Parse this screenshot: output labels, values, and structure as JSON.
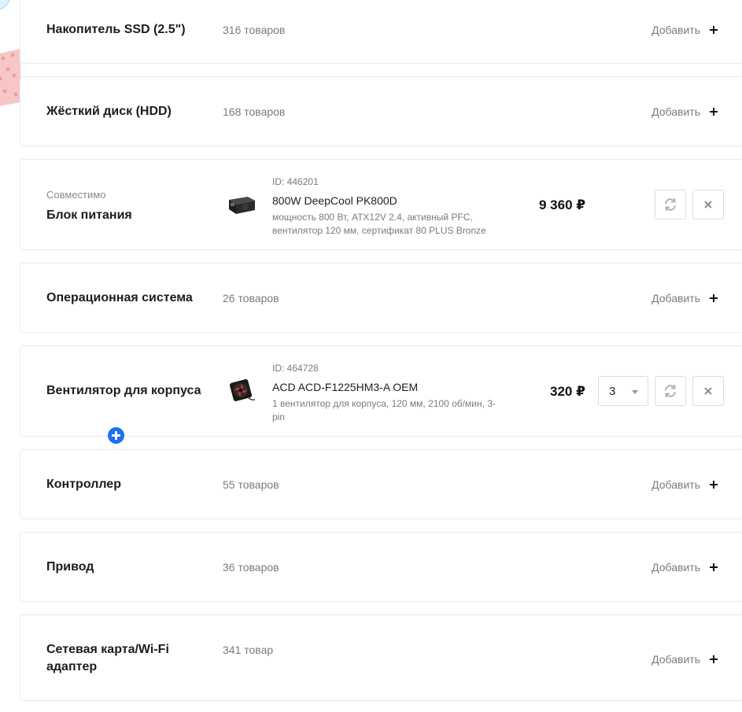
{
  "rows": {
    "ssd": {
      "title": "Накопитель SSD (2.5\")",
      "count": "316 товаров",
      "add_label": "Добавить"
    },
    "hdd": {
      "title": "Жёсткий диск (HDD)",
      "count": "168 товаров",
      "add_label": "Добавить"
    },
    "psu": {
      "status": "Совместимо",
      "title": "Блок питания",
      "product": {
        "id": "ID: 446201",
        "name": "800W DeepCool PK800D",
        "desc": "мощность 800 Вт, ATX12V 2.4, активный PFC, вентилятор 120 мм, сертификат 80 PLUS Bronze",
        "price": "9 360 ₽"
      }
    },
    "os": {
      "title": "Операционная система",
      "count": "26 товаров",
      "add_label": "Добавить"
    },
    "fan": {
      "title": "Вентилятор для корпуса",
      "product": {
        "id": "ID: 464728",
        "name": "ACD ACD-F1225HM3-A OEM",
        "desc": "1 вентилятор для корпуса, 120 мм, 2100 об/мин, 3-pin",
        "price": "320 ₽",
        "quantity": "3"
      }
    },
    "controller": {
      "title": "Контроллер",
      "count": "55 товаров",
      "add_label": "Добавить"
    },
    "drive": {
      "title": "Привод",
      "count": "36 товаров",
      "add_label": "Добавить"
    },
    "network": {
      "title": "Сетевая карта/Wi-Fi адаптер",
      "count": "341 товар",
      "add_label": "Добавить"
    }
  },
  "icons": {
    "add": "plus-icon",
    "replace": "refresh-icon",
    "remove": "close-icon",
    "quantity": "chevron-down-icon",
    "fab": "plus-circle-icon"
  },
  "colors": {
    "accent": "#1d6ff2",
    "muted_text": "#7b7b7b",
    "border": "#ebebeb"
  }
}
